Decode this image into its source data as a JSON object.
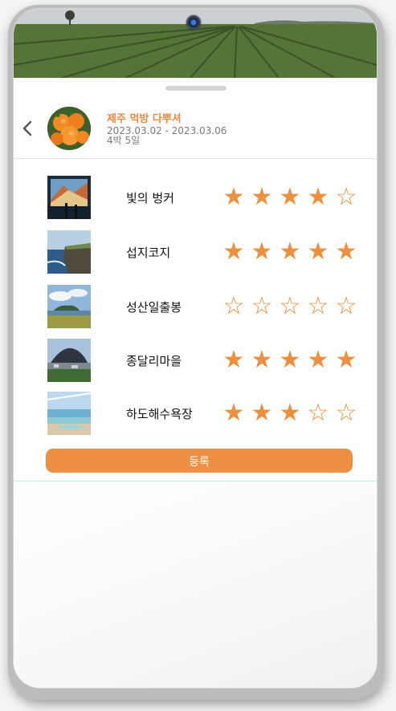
{
  "trip": {
    "title": "제주 먹방 다뿌셔",
    "dates": "2023.03.02 - 2023.03.06",
    "nights": "4박 5일"
  },
  "icons": {
    "back": "chevron-left-icon",
    "star_filled": "star-filled-icon",
    "star_empty": "star-outline-icon"
  },
  "colors": {
    "accent": "#ef8f41",
    "star": "#ee8f3d",
    "text_muted": "#7a7a7a"
  },
  "places": [
    {
      "name": "빛의 벙커",
      "rating": 4
    },
    {
      "name": "섭지코지",
      "rating": 5
    },
    {
      "name": "성산일출봉",
      "rating": 0
    },
    {
      "name": "종달리마을",
      "rating": 5
    },
    {
      "name": "하도해수욕장",
      "rating": 3
    }
  ],
  "max_rating": 5,
  "submit_label": "등록"
}
